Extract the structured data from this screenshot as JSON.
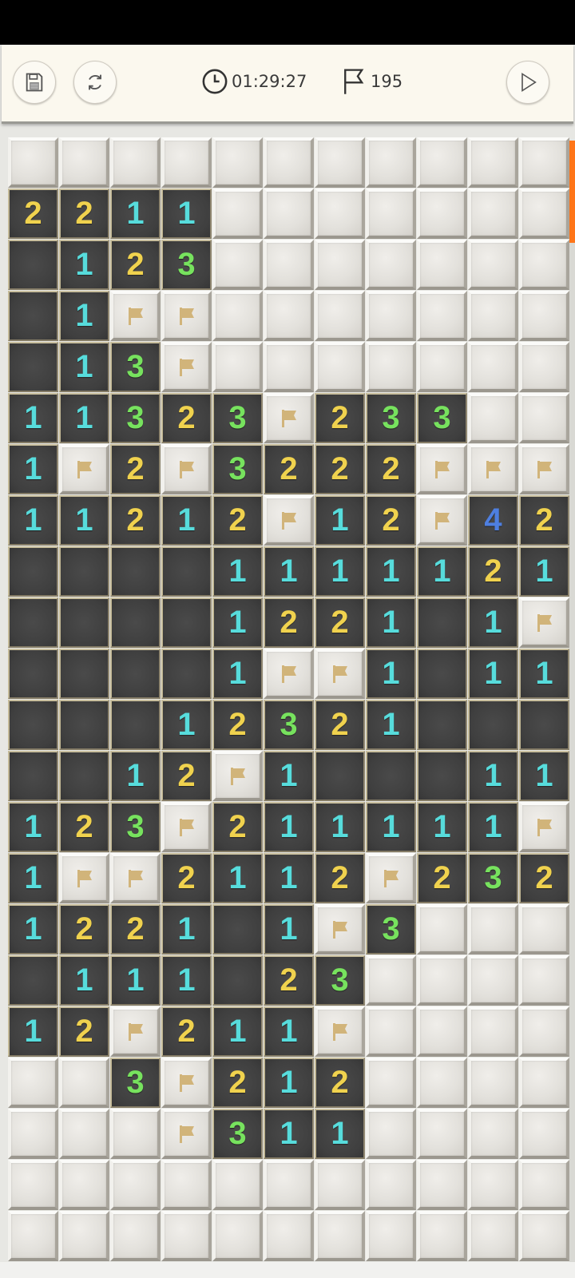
{
  "toolbar": {
    "timer": "01:29:27",
    "flags_remaining": "195"
  },
  "icons": {
    "save": "save-icon",
    "restart": "refresh-icon",
    "timer": "clock-icon",
    "flags": "flag-icon",
    "play": "play-icon"
  },
  "colors": {
    "n1": "#57dcdc",
    "n2": "#f0d24e",
    "n3": "#77e25e",
    "n4": "#4e7fe0",
    "flag": "#d1b47a",
    "scroll_accent": "#ff7518"
  },
  "board": {
    "cols": 11,
    "legend": "H = hidden tile, F = flagged tile, 0 = revealed empty, 1-8 = revealed number",
    "rows": [
      "HHHHHHHHHHH",
      "2211HHHHHHH",
      "0123HHHHHHH",
      "01FFHHHHHHH",
      "013FHHHHHHH",
      "11323F233HH",
      "1F2F3222FFF",
      "11212F12F42",
      "00001111121",
      "0000122101F",
      "00001FF1011",
      "00012321000",
      "0012F100011",
      "123F211111F",
      "1FF2112F232",
      "122101F3HHH",
      "011102 3HHHH",
      "12F211FHHHH",
      "HH3F212HHHH",
      "HHHF311HHHH",
      "HHHHHHHHHHH",
      "HHHHHHHHHHH"
    ]
  }
}
